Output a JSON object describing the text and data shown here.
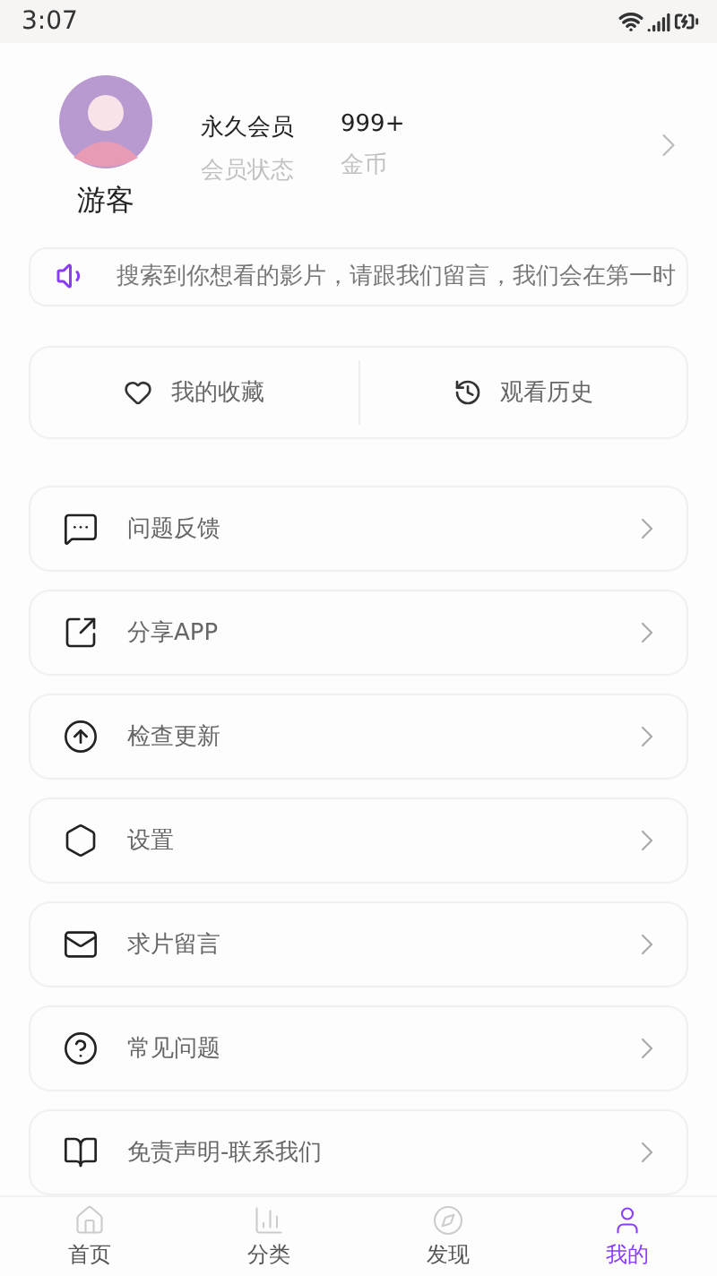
{
  "status_bar": {
    "time": "3:07"
  },
  "profile": {
    "name": "游客",
    "stats": [
      {
        "value": "永久会员",
        "label": "会员状态"
      },
      {
        "value": "999+",
        "label": "金币"
      }
    ]
  },
  "notice": {
    "text": "搜索到你想看的影片，请跟我们留言，我们会在第一时"
  },
  "shortcuts": [
    {
      "kind": "heart",
      "label": "我的收藏"
    },
    {
      "kind": "history",
      "label": "观看历史"
    }
  ],
  "menu": [
    {
      "kind": "feedback",
      "label": "问题反馈"
    },
    {
      "kind": "share",
      "label": "分享APP"
    },
    {
      "kind": "update",
      "label": "检查更新"
    },
    {
      "kind": "settings",
      "label": "设置"
    },
    {
      "kind": "mail",
      "label": "求片留言"
    },
    {
      "kind": "help",
      "label": "常见问题"
    },
    {
      "kind": "book",
      "label": "免责声明-联系我们"
    }
  ],
  "tab_bar": [
    {
      "kind": "home",
      "label": "首页",
      "selected": false
    },
    {
      "kind": "category",
      "label": "分类",
      "selected": false
    },
    {
      "kind": "discover",
      "label": "发现",
      "selected": false
    },
    {
      "kind": "me",
      "label": "我的",
      "selected": true
    }
  ]
}
